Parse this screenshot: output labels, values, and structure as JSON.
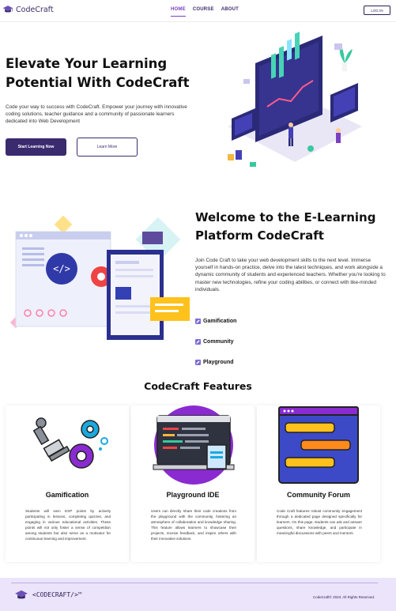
{
  "nav": {
    "brand": "CodeCraft",
    "links": [
      {
        "label": "HOME",
        "active": true
      },
      {
        "label": "COURSE",
        "active": false
      },
      {
        "label": "ABOUT",
        "active": false
      }
    ],
    "login_label": "LOG IN"
  },
  "hero": {
    "title": "Elevate Your Learning Potential With CodeCraft",
    "subtitle": "Code your way to success with CodeCraft. Empower your journey with innovative coding solutions, teacher guidance and a community of passionate learners dedicated into Web Development",
    "primary_button": "Start Learning Now",
    "secondary_button": "Learn More"
  },
  "welcome": {
    "title": "Welcome to the E-Learning Platform CodeCraft",
    "text": "Join Code Craft to take your web development skills to the next level. Immerse yourself in hands-on practice, delve into the latest techniques, and work alongside a dynamic community of students and experienced teachers. Whether you're looking to master new technologies, refine your coding abilities, or connect with like-minded individuals.",
    "features": [
      "Gamification",
      "Community",
      "Playground"
    ]
  },
  "features": {
    "title": "CodeCraft Features",
    "cards": [
      {
        "title": "Gamification",
        "text": "Students will earn EXP points by actively participating in lessons, completing quizzes, and engaging in various educational activities. These points will not only foster a sense of competition among students but also serve as a motivator for continuous learning and improvement."
      },
      {
        "title": "Playground IDE",
        "text": "Users can directly share their code creations from the playground with the community, fostering an atmosphere of collaboration and knowledge sharing. This feature allows learners to showcase their projects, receive feedback, and inspire others with their innovative solutions."
      },
      {
        "title": "Community Forum",
        "text": "Code Craft features robust community engagement through a dedicated page designed specifically for learners. On this page, students can ask and answer questions, share knowledge, and participate in meaningful discussions with peers and mentors."
      }
    ]
  },
  "footer": {
    "brand": "<CODECRAFT/>™",
    "copyright": "CodeCraft© 2023. All Rights Reserved."
  },
  "colors": {
    "brand_dark": "#3a2a6e",
    "accent_purple": "#7b3fc2",
    "footer_bg": "#ebe4fb"
  }
}
